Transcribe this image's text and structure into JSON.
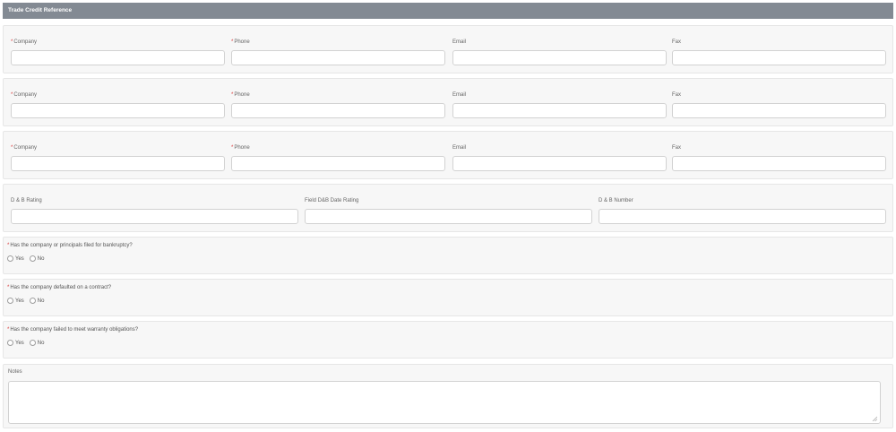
{
  "section_title": "Trade Credit Reference",
  "reference_labels": {
    "company": "Company",
    "phone": "Phone",
    "email": "Email",
    "fax": "Fax",
    "required_mark": "*"
  },
  "references": [
    {
      "company": "",
      "phone": "",
      "email": "",
      "fax": ""
    },
    {
      "company": "",
      "phone": "",
      "email": "",
      "fax": ""
    },
    {
      "company": "",
      "phone": "",
      "email": "",
      "fax": ""
    }
  ],
  "dnb": {
    "rating_label": "D & B Rating",
    "date_label": "Field D&B Date Rating",
    "number_label": "D & B Number",
    "rating_value": "",
    "date_value": "",
    "number_value": ""
  },
  "questions": [
    {
      "label": "Has the company or principals filed for bankruptcy?",
      "selected": null
    },
    {
      "label": "Has the company defaulted on a contract?",
      "selected": null
    },
    {
      "label": "Has the company failed to meet warranty obligations?",
      "selected": null
    }
  ],
  "radio_options": {
    "yes": "Yes",
    "no": "No"
  },
  "notes": {
    "label": "Notes",
    "value": ""
  },
  "colors": {
    "header_bg": "#838a93",
    "required": "#d93a3a",
    "panel_bg": "#f7f7f7"
  }
}
